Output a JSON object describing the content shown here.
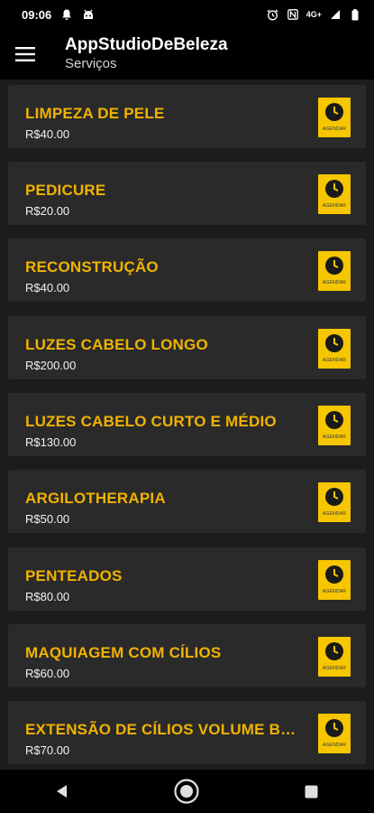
{
  "status": {
    "time": "09:06",
    "network": "4G+"
  },
  "header": {
    "title": "AppStudioDeBeleza",
    "subtitle": "Serviços"
  },
  "services": [
    {
      "name": "LIMPEZA DE PELE",
      "price": "R$40.00",
      "button_label": "AGENDAR"
    },
    {
      "name": "PEDICURE",
      "price": "R$20.00",
      "button_label": "AGENDAR"
    },
    {
      "name": "RECONSTRUÇÃO",
      "price": "R$40.00",
      "button_label": "AGENDAR"
    },
    {
      "name": "LUZES CABELO LONGO",
      "price": "R$200.00",
      "button_label": "AGENDAR"
    },
    {
      "name": "LUZES CABELO CURTO E MÉDIO",
      "price": "R$130.00",
      "button_label": "AGENDAR"
    },
    {
      "name": "ARGILOTHERAPIA",
      "price": "R$50.00",
      "button_label": "AGENDAR"
    },
    {
      "name": "PENTEADOS",
      "price": "R$80.00",
      "button_label": "AGENDAR"
    },
    {
      "name": "MAQUIAGEM COM CÍLIOS",
      "price": "R$60.00",
      "button_label": "AGENDAR"
    },
    {
      "name": "EXTENSÃO DE CÍLIOS VOLUME BRASILEIRO",
      "price": "R$70.00",
      "button_label": "AGENDAR"
    }
  ],
  "colors": {
    "accent": "#f0b300",
    "button": "#f6c600",
    "card": "#2a2a2a",
    "background": "#1c1c1c"
  }
}
